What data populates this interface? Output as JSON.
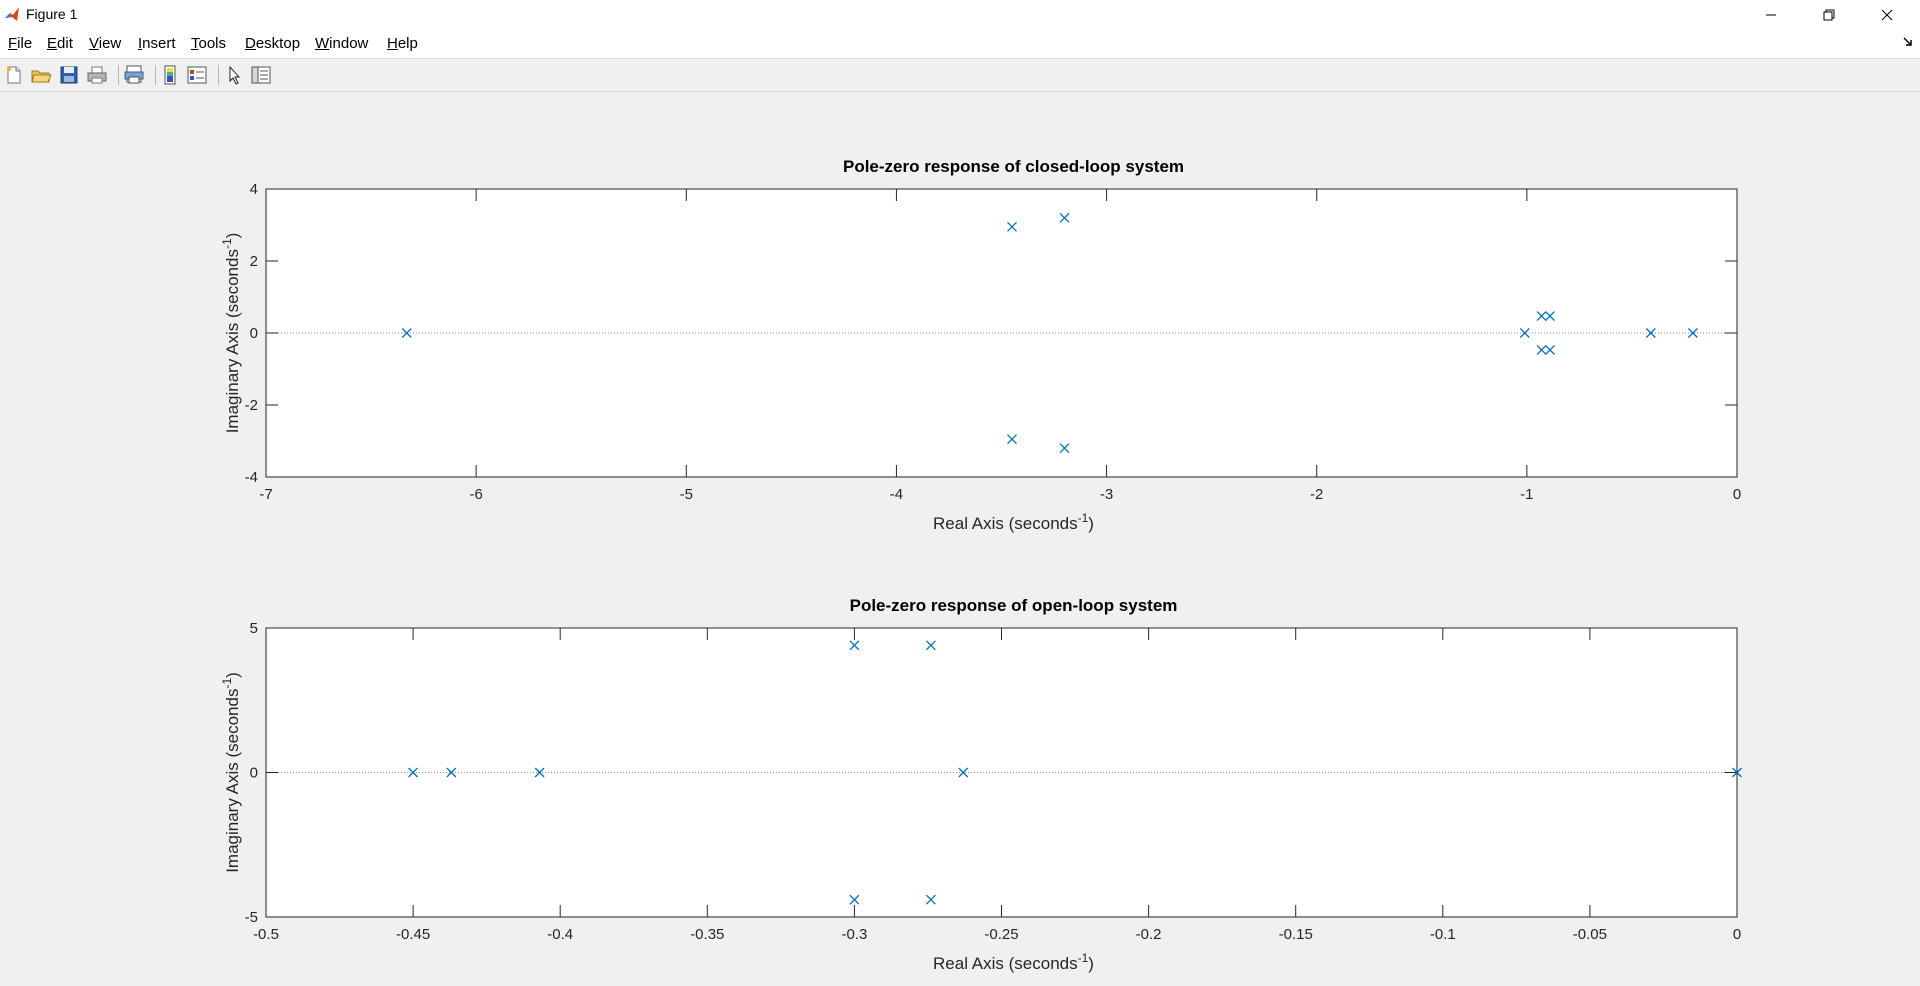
{
  "window": {
    "title": "Figure 1"
  },
  "menu": [
    {
      "ul": "F",
      "rest": "ile"
    },
    {
      "ul": "E",
      "rest": "dit"
    },
    {
      "ul": "V",
      "rest": "iew"
    },
    {
      "ul": "I",
      "rest": "nsert"
    },
    {
      "ul": "T",
      "rest": "ools"
    },
    {
      "ul": "D",
      "rest": "esktop"
    },
    {
      "ul": "W",
      "rest": "indow"
    },
    {
      "ul": "H",
      "rest": "elp"
    }
  ],
  "toolbar": [
    "new-figure-icon",
    "open-file-icon",
    "save-icon",
    "print-icon",
    "print-preview-icon",
    "colorbar-icon",
    "legend-icon",
    "edit-plot-icon",
    "property-inspector-icon"
  ],
  "colors": {
    "marker": "#0072bd",
    "axis": "#262626"
  },
  "chart_data": [
    {
      "type": "scatter",
      "title": "Pole-zero response of closed-loop system",
      "xlabel": "Real Axis (seconds",
      "ylabel": "Imaginary Axis (seconds",
      "label_exponent": "-1",
      "xlim": [
        -7,
        0
      ],
      "ylim": [
        -4,
        4
      ],
      "xticks": [
        -7,
        -6,
        -5,
        -4,
        -3,
        -2,
        -1,
        0
      ],
      "yticks": [
        -4,
        -2,
        0,
        2,
        4
      ],
      "marker": "x",
      "points": [
        {
          "x": -6.33,
          "y": 0
        },
        {
          "x": -3.45,
          "y": 2.95
        },
        {
          "x": -3.45,
          "y": -2.95
        },
        {
          "x": -3.2,
          "y": 3.2
        },
        {
          "x": -3.2,
          "y": -3.2
        },
        {
          "x": -1.01,
          "y": 0
        },
        {
          "x": -0.93,
          "y": 0.47
        },
        {
          "x": -0.93,
          "y": -0.47
        },
        {
          "x": -0.89,
          "y": 0.47
        },
        {
          "x": -0.89,
          "y": -0.47
        },
        {
          "x": -0.41,
          "y": 0
        },
        {
          "x": -0.21,
          "y": 0
        }
      ]
    },
    {
      "type": "scatter",
      "title": "Pole-zero response of open-loop system",
      "xlabel": "Real Axis (seconds",
      "ylabel": "Imaginary Axis (seconds",
      "label_exponent": "-1",
      "xlim": [
        -0.5,
        0
      ],
      "ylim": [
        -5,
        5
      ],
      "xticks": [
        -0.5,
        -0.45,
        -0.4,
        -0.35,
        -0.3,
        -0.25,
        -0.2,
        -0.15,
        -0.1,
        -0.05,
        0
      ],
      "yticks": [
        -5,
        0,
        5
      ],
      "marker": "x",
      "points": [
        {
          "x": -0.45,
          "y": 0
        },
        {
          "x": -0.437,
          "y": 0
        },
        {
          "x": -0.407,
          "y": 0
        },
        {
          "x": -0.3,
          "y": 4.4
        },
        {
          "x": -0.3,
          "y": -4.4
        },
        {
          "x": -0.274,
          "y": 4.4
        },
        {
          "x": -0.274,
          "y": -4.4
        },
        {
          "x": -0.263,
          "y": 0
        },
        {
          "x": 0,
          "y": 0
        }
      ]
    }
  ]
}
